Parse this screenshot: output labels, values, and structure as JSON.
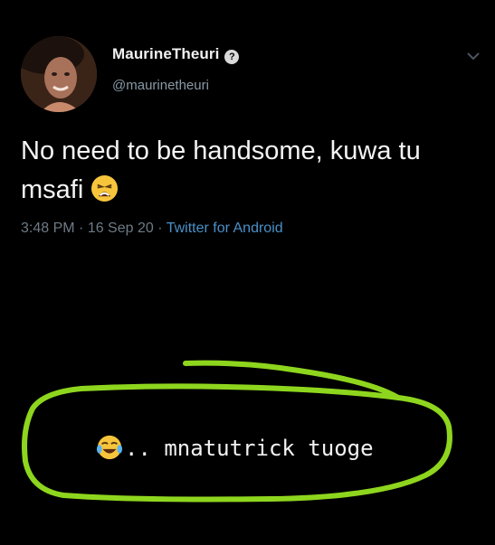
{
  "tweet": {
    "display_name": "MaurineTheuri",
    "verified_icon": "verified-badge-icon",
    "handle": "@maurinetheuri",
    "text": "No need to be handsome, kuwa tu msafi",
    "emoji": "weary-face-emoji",
    "time": "3:48 PM",
    "date": "16 Sep 20",
    "source": "Twitter for Android",
    "separator": " · "
  },
  "annotation": {
    "emoji": "tears-of-joy-emoji",
    "text": ".. mnatutrick tuoge",
    "outline_color": "#8ed61e"
  },
  "colors": {
    "background": "#000000",
    "link": "#4a90c8",
    "muted": "#6e7b86"
  }
}
